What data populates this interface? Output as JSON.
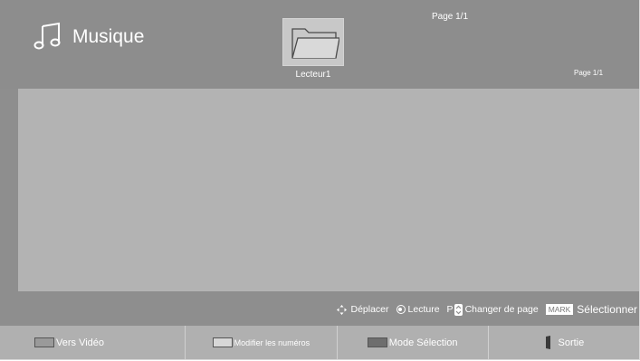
{
  "app": {
    "title": "Musique",
    "icon": "music-note-icon"
  },
  "header": {
    "page_indicator_top": "Page 1/1",
    "page_indicator_right": "Page 1/1",
    "folder": {
      "label": "Lecteur1",
      "icon": "folder-icon"
    }
  },
  "help_bar": {
    "move": {
      "icon": "arrows-move-icon",
      "label": "Déplacer"
    },
    "play": {
      "icon": "ok-button-icon",
      "label": "Lecture"
    },
    "page": {
      "key": "P",
      "icon": "page-updown-icon",
      "label": "Changer de page"
    },
    "select": {
      "key": "MARK",
      "label": "Sélectionner"
    }
  },
  "footer": {
    "buttons": [
      {
        "label": "Vers Vidéo",
        "color": "#ff0000"
      },
      {
        "label": "Modifier les numéros",
        "color": "#00ff00"
      },
      {
        "label": "Mode Sélection",
        "color": "#ffff00"
      },
      {
        "label": "Sortie",
        "icon": "exit-icon"
      }
    ]
  },
  "colors": {
    "background": "#8e8e8e",
    "content_area": "#b3b3b3",
    "footer_button": "#b0b0b0",
    "text": "#ffffff"
  }
}
